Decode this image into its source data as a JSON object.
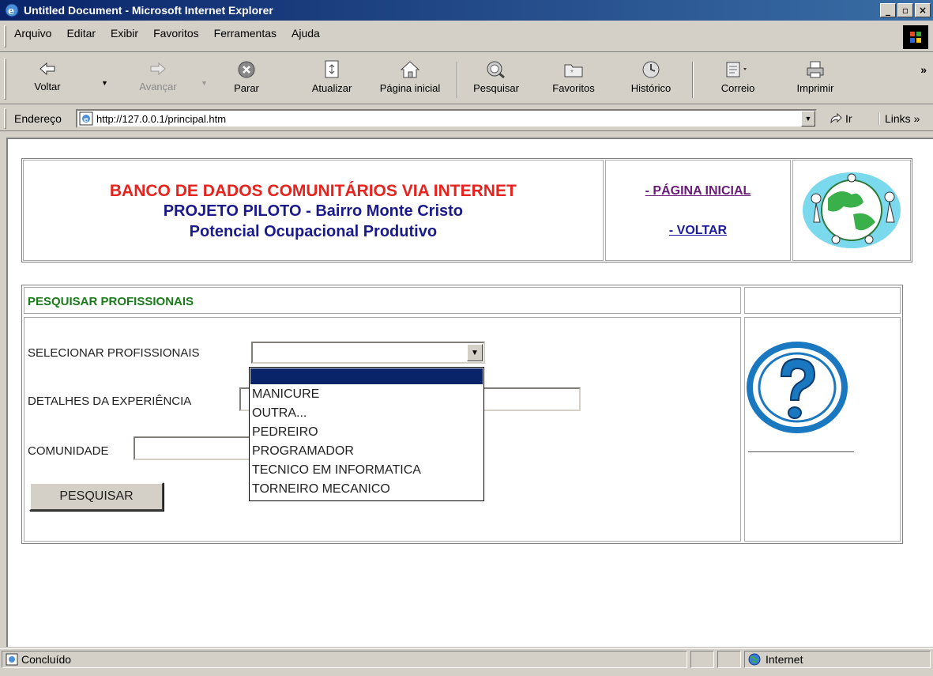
{
  "window": {
    "title": "Untitled Document - Microsoft Internet Explorer",
    "controls": [
      "_",
      "▫",
      "×"
    ]
  },
  "menu": [
    "Arquivo",
    "Editar",
    "Exibir",
    "Favoritos",
    "Ferramentas",
    "Ajuda"
  ],
  "toolbar": {
    "back": "Voltar",
    "forward": "Avançar",
    "stop": "Parar",
    "refresh": "Atualizar",
    "home": "Página inicial",
    "search": "Pesquisar",
    "favorites": "Favoritos",
    "history": "Histórico",
    "mail": "Correio",
    "print": "Imprimir",
    "more": "»"
  },
  "address": {
    "label": "Endereço",
    "url": "http://127.0.0.1/principal.htm",
    "go": "Ir",
    "links": "Links »"
  },
  "page": {
    "header": {
      "line1": "BANCO DE DADOS COMUNITÁRIOS VIA INTERNET",
      "line2": "PROJETO PILOTO - Bairro Monte Cristo",
      "line3": "Potencial Ocupacional Produtivo",
      "nav_home": "- PÁGINA INICIAL",
      "nav_back": "- VOLTAR"
    },
    "search": {
      "heading": "PESQUISAR PROFISSIONAIS",
      "select_label": "SELECIONAR PROFISSIONAIS",
      "select_value": "",
      "experience_label": "DETALHES DA EXPERIÊNCIA",
      "experience_value": "",
      "community_label": "COMUNIDADE",
      "community_value": "",
      "button": "PESQUISAR",
      "options": [
        "",
        "MANICURE",
        "OUTRA...",
        "PEDREIRO",
        "PROGRAMADOR",
        "TECNICO EM INFORMATICA",
        "TORNEIRO MECANICO"
      ]
    }
  },
  "status": {
    "text": "Concluído",
    "zone": "Internet"
  },
  "colors": {
    "title_red": "#e8231e",
    "title_navy": "#1a1a8c",
    "heading_green": "#1a7a1a",
    "link_visited": "#6a1a7a",
    "link": "#1a1a9c",
    "selection": "#0a246a"
  }
}
